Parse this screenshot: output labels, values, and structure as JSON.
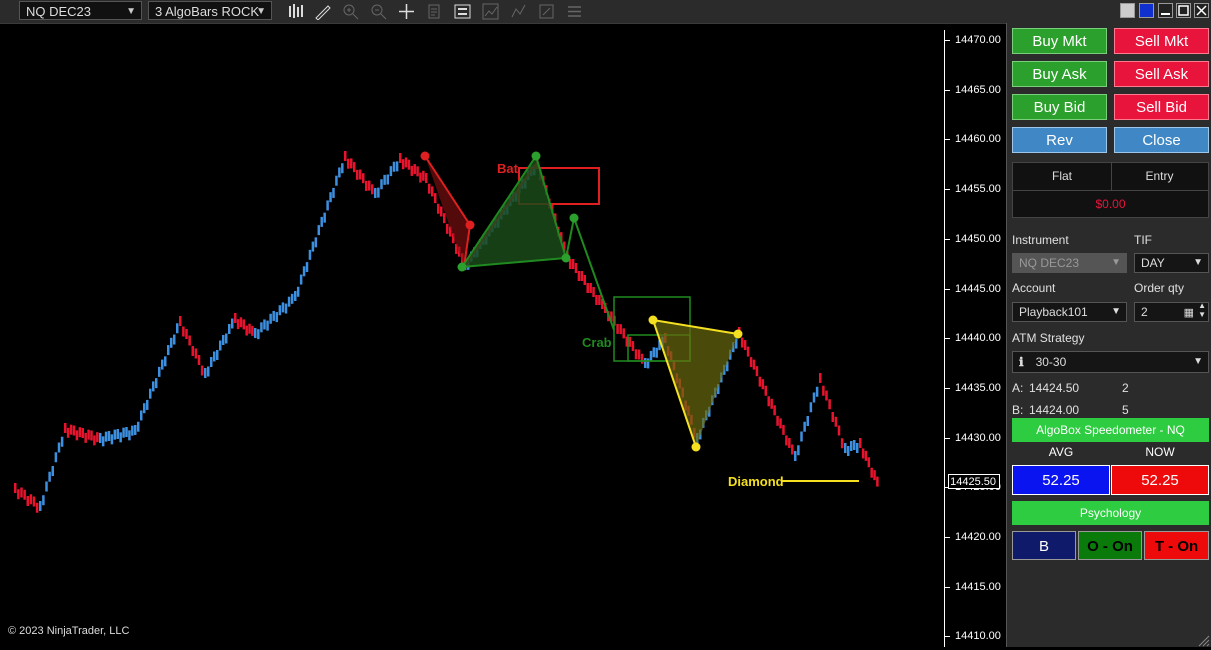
{
  "toolbar": {
    "instrument": "NQ DEC23",
    "bar_type": "3 AlgoBars ROCK",
    "icons": [
      "bar-type-icon",
      "draw-icon",
      "zoom-in-icon",
      "zoom-out-icon",
      "crosshair-icon",
      "properties-icon",
      "strategies-icon",
      "indicators-icon",
      "templates-icon",
      "data-box-icon",
      "more-icon"
    ]
  },
  "chart": {
    "price_labels": [
      "14470.00",
      "14465.00",
      "14460.00",
      "14455.00",
      "14450.00",
      "14445.00",
      "14440.00",
      "14435.00",
      "14430.00",
      "14425.00",
      "14420.00",
      "14415.00",
      "14410.00"
    ],
    "current_price": "14425.50",
    "copyright": "© 2023 NinjaTrader, LLC",
    "patterns": {
      "bat": "Bat",
      "crab": "Crab",
      "diamond": "Diamond"
    },
    "colors": {
      "up": "#3d8fe0",
      "down": "#e8142e",
      "bat": "#e02020",
      "crab": "#1f8a1f",
      "diamond": "#f4e020"
    }
  },
  "panel": {
    "buy_mkt": "Buy Mkt",
    "sell_mkt": "Sell Mkt",
    "buy_ask": "Buy Ask",
    "sell_ask": "Sell Ask",
    "buy_bid": "Buy Bid",
    "sell_bid": "Sell Bid",
    "rev": "Rev",
    "close": "Close",
    "position": "Flat",
    "entry": "Entry",
    "pnl": "$0.00",
    "instrument_label": "Instrument",
    "instrument_value": "NQ DEC23",
    "tif_label": "TIF",
    "tif_value": "DAY",
    "account_label": "Account",
    "account_value": "Playback101",
    "qty_label": "Order qty",
    "qty_value": "2",
    "atm_label": "ATM Strategy",
    "atm_value": "30-30",
    "a_label": "A:",
    "a_price": "14424.50",
    "a_qty": "2",
    "b_label": "B:",
    "b_price": "14424.00",
    "b_qty": "5",
    "speedometer": "AlgoBox Speedometer - NQ",
    "avg_label": "AVG",
    "now_label": "NOW",
    "avg_value": "52.25",
    "now_value": "52.25",
    "psychology": "Psychology",
    "b_btn": "B",
    "o_btn": "O - On",
    "t_btn": "T - On"
  }
}
